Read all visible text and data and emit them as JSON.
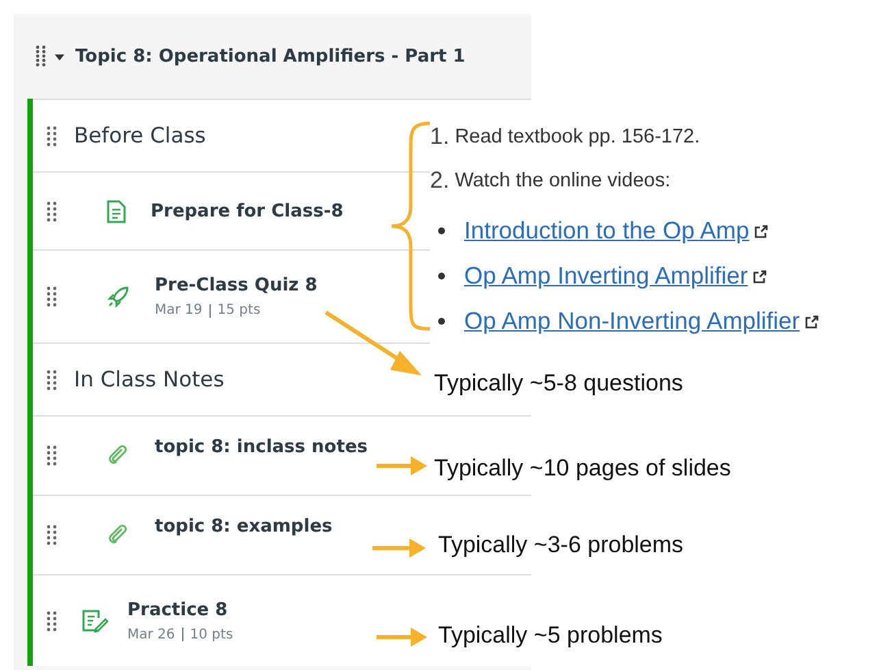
{
  "module": {
    "title": "Topic 8: Operational Amplifiers - Part 1",
    "expanded": true
  },
  "items": [
    {
      "kind": "header",
      "title": "Before Class"
    },
    {
      "kind": "page",
      "title": "Prepare for Class-8"
    },
    {
      "kind": "quiz",
      "title": "Pre-Class Quiz 8",
      "date": "Mar 19",
      "points": "15 pts"
    },
    {
      "kind": "header",
      "title": "In Class Notes"
    },
    {
      "kind": "attachment",
      "title": "topic 8: inclass notes"
    },
    {
      "kind": "attachment",
      "title": "topic 8: examples"
    },
    {
      "kind": "assignment",
      "title": "Practice 8",
      "date": "Mar 26",
      "points": "10 pts"
    }
  ],
  "callout": {
    "steps": [
      {
        "number": "1.",
        "text": "Read textbook pp. 156-172."
      },
      {
        "number": "2.",
        "text": "Watch the online videos:"
      }
    ],
    "links": [
      "Introduction to the Op Amp",
      "Op Amp Inverting Amplifier",
      "Op Amp Non-Inverting Amplifier"
    ]
  },
  "notes": [
    "Typically ~5-8 questions",
    "Typically ~10 pages of slides",
    "Typically ~3-6 problems",
    "Typically ~5 problems"
  ]
}
